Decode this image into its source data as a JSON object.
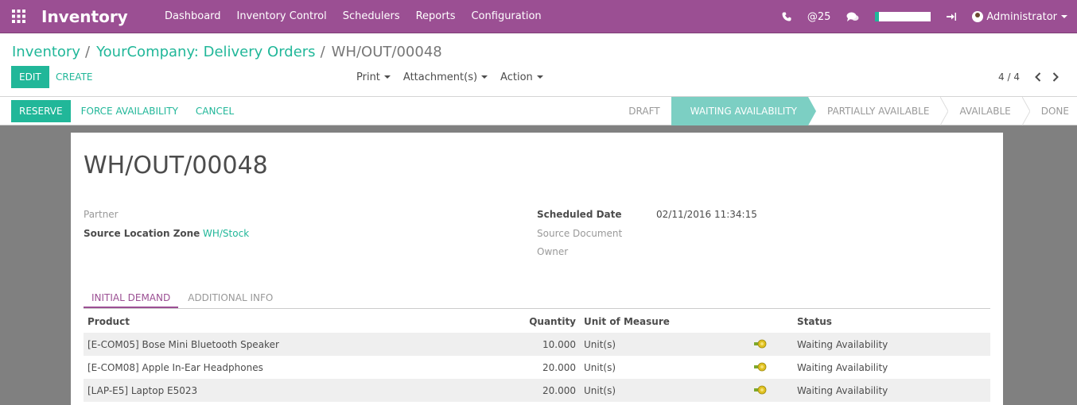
{
  "navbar": {
    "brand": "Inventory",
    "menu": [
      "Dashboard",
      "Inventory Control",
      "Schedulers",
      "Reports",
      "Configuration"
    ],
    "mentions": "@25",
    "user": "Administrator"
  },
  "breadcrumb": {
    "items": [
      "Inventory",
      "YourCompany: Delivery Orders"
    ],
    "current": "WH/OUT/00048",
    "separator": "/"
  },
  "toolbar": {
    "edit_label": "EDIT",
    "create_label": "CREATE",
    "print_label": "Print",
    "attachment_label": "Attachment(s)",
    "action_label": "Action"
  },
  "pager": {
    "value": "4 / 4"
  },
  "status_actions": {
    "reserve_label": "RESERVE",
    "force_label": "FORCE AVAILABILITY",
    "cancel_label": "CANCEL"
  },
  "steps": [
    "DRAFT",
    "WAITING AVAILABILITY",
    "PARTIALLY AVAILABLE",
    "AVAILABLE",
    "DONE"
  ],
  "active_step": "WAITING AVAILABILITY",
  "form": {
    "title": "WH/OUT/00048",
    "partner_label": "Partner",
    "partner_value": "",
    "source_zone_label": "Source Location Zone",
    "source_zone_value": "WH/Stock",
    "scheduled_label": "Scheduled Date",
    "scheduled_value": "02/11/2016 11:34:15",
    "source_doc_label": "Source Document",
    "owner_label": "Owner"
  },
  "tabs": [
    "INITIAL DEMAND",
    "ADDITIONAL INFO"
  ],
  "grid": {
    "headers": [
      "Product",
      "Quantity",
      "Unit of Measure",
      "Status"
    ],
    "rows": [
      {
        "product": "[E-COM05] Bose Mini Bluetooth Speaker",
        "qty": "10.000",
        "uom": "Unit(s)",
        "status": "Waiting Availability"
      },
      {
        "product": "[E-COM08] Apple In-Ear Headphones",
        "qty": "20.000",
        "uom": "Unit(s)",
        "status": "Waiting Availability"
      },
      {
        "product": "[LAP-E5] Laptop E5023",
        "qty": "20.000",
        "uom": "Unit(s)",
        "status": "Waiting Availability"
      }
    ]
  },
  "colors": {
    "navbar": "#9b4f93",
    "accent": "#21b799",
    "active_step": "#7ccfc3"
  }
}
